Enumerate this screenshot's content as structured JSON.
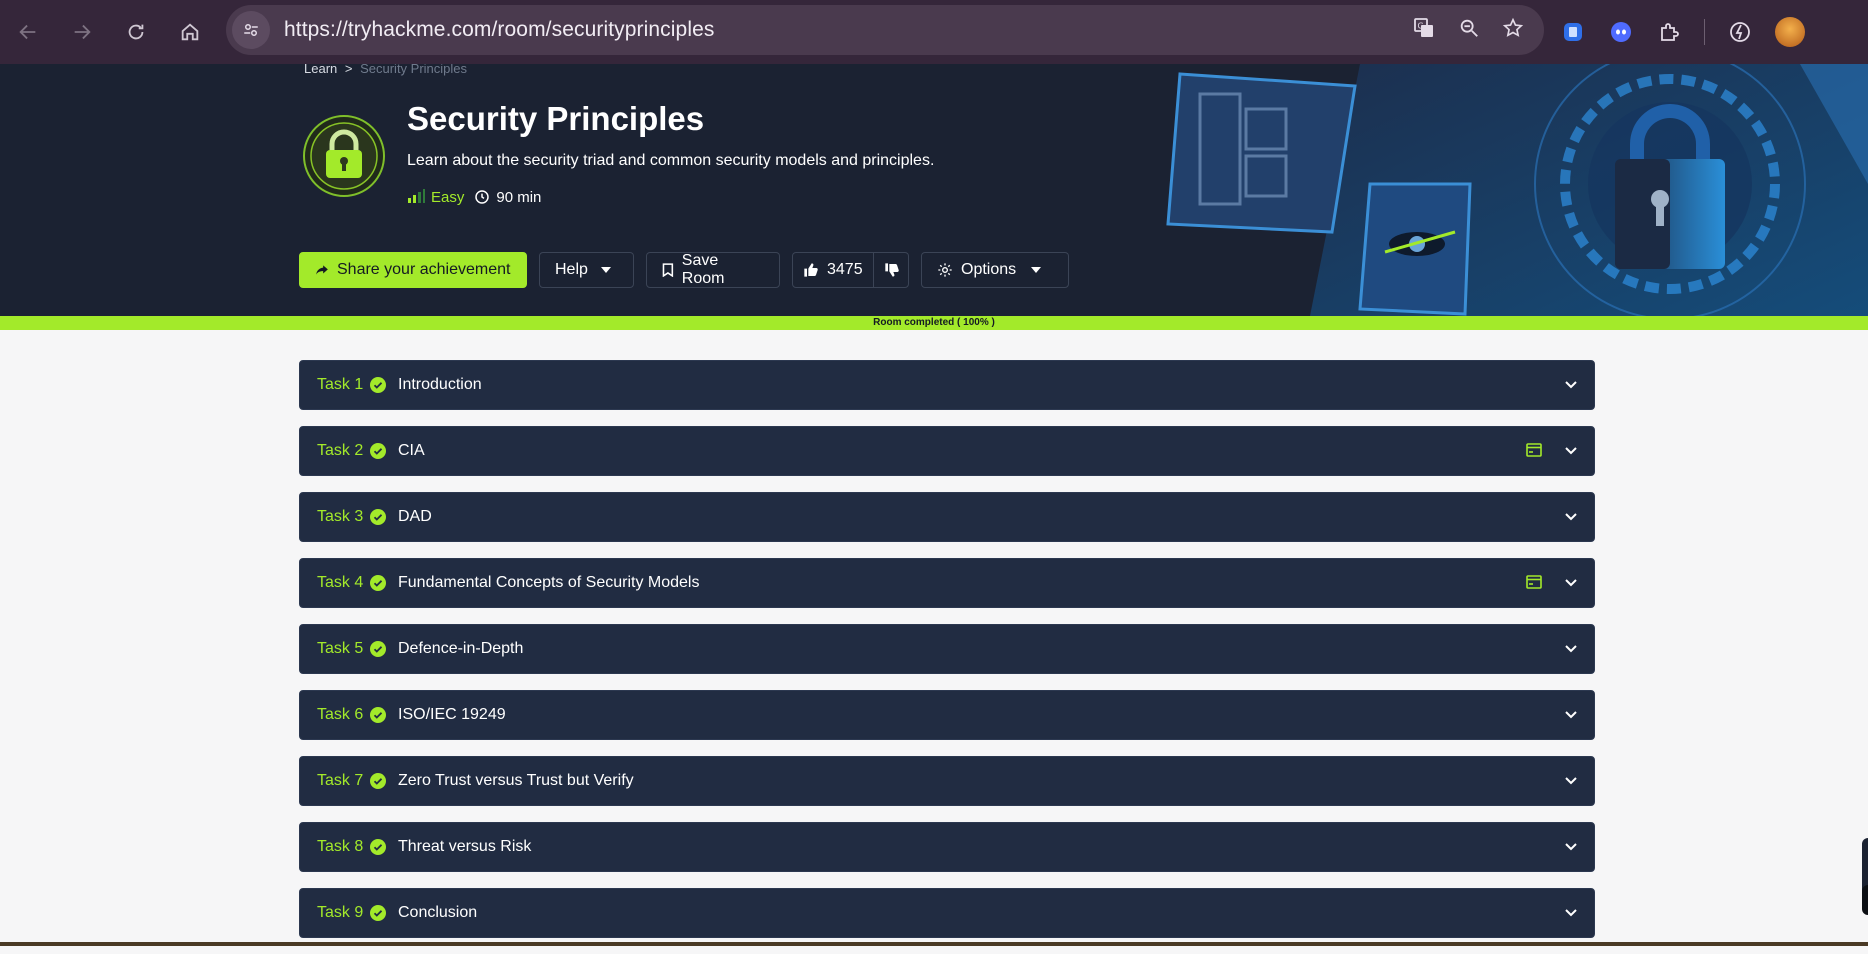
{
  "browser": {
    "url": "https://tryhackme.com/room/securityprinciples",
    "icons": [
      "back-icon",
      "forward-icon",
      "reload-icon",
      "home-icon",
      "site-settings-icon",
      "translate-icon",
      "zoom-icon",
      "bookmark-star-icon",
      "extension-docs-icon",
      "extension-bot-icon",
      "extensions-puzzle-icon",
      "performance-icon",
      "profile-avatar"
    ]
  },
  "hero": {
    "breadcrumb": {
      "root": "Learn",
      "separator": ">",
      "current": "Security Principles"
    },
    "title": "Security Principles",
    "description": "Learn about the security triad and common security models and principles.",
    "difficulty": "Easy",
    "duration": "90 min",
    "colors": {
      "accent": "#a3ea2a",
      "hero_bg": "#1b2232"
    }
  },
  "actions": {
    "share_label": "Share your achievement",
    "help_label": "Help",
    "save_label": "Save Room",
    "upvotes": "3475",
    "options_label": "Options"
  },
  "progress": {
    "label": "Room completed ( 100% )",
    "value": 1.0
  },
  "tasks": [
    {
      "num": "Task 1",
      "title": "Introduction",
      "has_machine": false,
      "completed": true
    },
    {
      "num": "Task 2",
      "title": "CIA",
      "has_machine": true,
      "completed": true
    },
    {
      "num": "Task 3",
      "title": "DAD",
      "has_machine": false,
      "completed": true
    },
    {
      "num": "Task 4",
      "title": "Fundamental Concepts of Security Models",
      "has_machine": true,
      "completed": true
    },
    {
      "num": "Task 5",
      "title": "Defence-in-Depth",
      "has_machine": false,
      "completed": true
    },
    {
      "num": "Task 6",
      "title": "ISO/IEC 19249",
      "has_machine": false,
      "completed": true
    },
    {
      "num": "Task 7",
      "title": "Zero Trust versus Trust but Verify",
      "has_machine": false,
      "completed": true
    },
    {
      "num": "Task 8",
      "title": "Threat versus Risk",
      "has_machine": false,
      "completed": true
    },
    {
      "num": "Task 9",
      "title": "Conclusion",
      "has_machine": false,
      "completed": true
    }
  ]
}
